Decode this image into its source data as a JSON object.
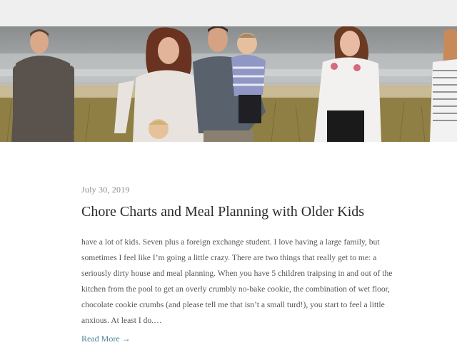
{
  "post": {
    "date": "July 30, 2019",
    "title": "Chore Charts and Meal Planning with Older Kids",
    "excerpt": "have a lot of kids. Seven plus a foreign exchange student. I love having a large family, but sometimes I feel like I’m going a little crazy. There are two things that really get to me: a seriously dirty house and meal planning. When you have 5 children traipsing in and out of the kitchen from the pool to get an overly crumbly no-bake cookie, the combination of wet floor, chocolate cookie crumbs (and please tell me that isn’t a small turd!), you start to feel a little anxious. At least I do.…",
    "read_more_label": "Read More →"
  },
  "colors": {
    "top_bar": "#f0eff0",
    "link": "#4a8591",
    "title": "#2b2b2b",
    "body_text": "#555555",
    "date": "#8a8a8a"
  }
}
